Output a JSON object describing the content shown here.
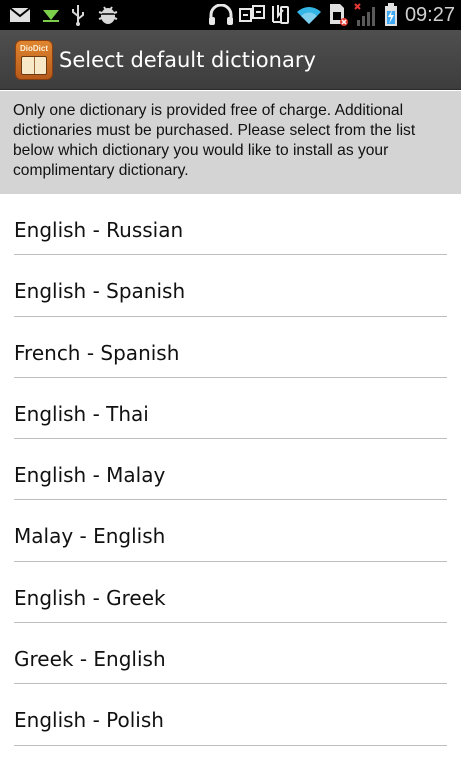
{
  "status_bar": {
    "time": "09:27",
    "icons_left": [
      "gmail-icon",
      "download-icon",
      "usb-icon",
      "android-debug-icon"
    ],
    "icons_right": [
      "headset-icon",
      "screen-mirror-icon",
      "nfc-icon",
      "wifi-icon",
      "sim-card-icon",
      "signal-icon",
      "battery-charging-icon"
    ]
  },
  "action_bar": {
    "app_icon_text": "DioDict",
    "title": "Select default dictionary"
  },
  "notice": {
    "text": "Only one dictionary is provided free of charge. Additional dictionaries must be purchased. Please select from the list below which dictionary you would like to install as your complimentary dictionary."
  },
  "dictionaries": [
    {
      "label": "English - Russian"
    },
    {
      "label": "English - Spanish"
    },
    {
      "label": "French - Spanish"
    },
    {
      "label": "English - Thai"
    },
    {
      "label": "English - Malay"
    },
    {
      "label": "Malay - English"
    },
    {
      "label": "English - Greek"
    },
    {
      "label": "Greek - English"
    },
    {
      "label": "English - Polish"
    }
  ],
  "colors": {
    "status_bar_bg": "#000000",
    "action_bar_bg": "#474747",
    "notice_bg": "#d4d4d4",
    "wifi_accent": "#33b5e5",
    "battery_accent": "#3fa9f5"
  }
}
